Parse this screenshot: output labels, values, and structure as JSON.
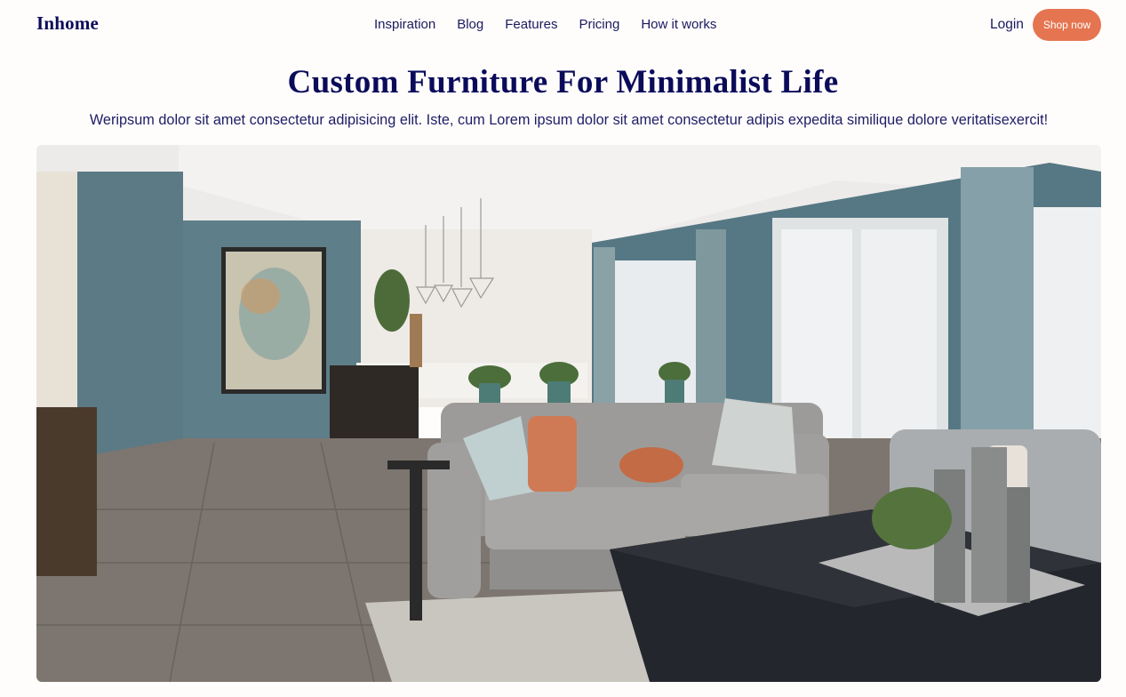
{
  "nav": {
    "logo": "Inhome",
    "links": [
      "Inspiration",
      "Blog",
      "Features",
      "Pricing",
      "How it works"
    ],
    "login": "Login",
    "shop_button": "Shop now"
  },
  "hero": {
    "title": "Custom Furniture For Minimalist Life",
    "subtitle": "Weripsum dolor sit amet consectetur adipisicing elit. Iste, cum Lorem ipsum dolor sit amet consectetur adipis expedita similique dolore veritatisexercit!",
    "image_alt": "Modern living room with grey sofa, orange cushions and blue walls"
  },
  "colors": {
    "accent": "#e57550",
    "text": "#0b0b5a",
    "background": "#fffdfc"
  }
}
